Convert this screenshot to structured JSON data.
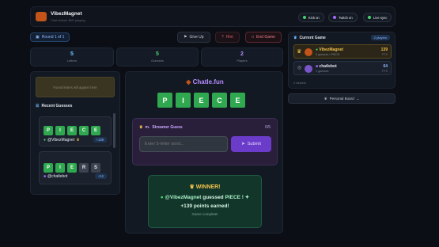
{
  "app": {
    "title": "VibezMagnet",
    "subtitle": "Chat kicked JBG playing"
  },
  "header_pills": [
    {
      "label": "Kick on",
      "color": "#47d16c"
    },
    {
      "label": "Twitch on",
      "color": "#a26bff"
    },
    {
      "label": "Live sync",
      "color": "#47d16c"
    }
  ],
  "round": {
    "label": "Round 1 of 1"
  },
  "actions": {
    "give_up": "Give Up",
    "hint": "Hint",
    "end_game": "End Game"
  },
  "stats": [
    {
      "value": "5",
      "label": "Letters"
    },
    {
      "value": "5",
      "label": "Guesses"
    },
    {
      "value": "2",
      "label": "Players"
    }
  ],
  "left": {
    "found_placeholder": "Found letters will appear here",
    "recent_title": "Recent Guesses",
    "guesses": [
      {
        "letters": [
          "P",
          "I",
          "E",
          "C",
          "E"
        ],
        "states": [
          "g",
          "g",
          "g",
          "g",
          "g"
        ],
        "user": "@VibezMagnet",
        "points": "+139"
      },
      {
        "letters": [
          "P",
          "I",
          "E",
          "R",
          "S"
        ],
        "states": [
          "g",
          "g",
          "g",
          "gr",
          "gr"
        ],
        "user": "@chatlebot",
        "points": "+12"
      }
    ]
  },
  "center": {
    "brand": "Chatle.fun",
    "answer": [
      "P",
      "I",
      "E",
      "C",
      "E"
    ],
    "guess_box": {
      "title": "Streamer Guess",
      "count": "0/5",
      "placeholder": "Enter 5-letter word...",
      "submit": "Submit"
    },
    "winner": {
      "title": "WINNER!",
      "user": "@VibezMagnet",
      "message": "guessed",
      "word": "PIECE !",
      "points": "+139 points earned!",
      "status": "Game complete!"
    }
  },
  "right": {
    "title": "Current Game",
    "badge": "2 players",
    "players": [
      {
        "name": "VibezMagnet",
        "meta": "5 guesses • PIECE",
        "points": "139",
        "pts_label": "PTS",
        "color": "#2fa84f"
      },
      {
        "name": "chatlebot",
        "meta": "1 guesses",
        "points": "64",
        "pts_label": "PTS",
        "color": "#a26bff"
      }
    ],
    "viewers": "2 viewers",
    "personal_board": "Personal Board"
  },
  "colors": {
    "accent": "#6b3cc9",
    "correct": "#2fa84f",
    "gold": "#f2c14e"
  }
}
